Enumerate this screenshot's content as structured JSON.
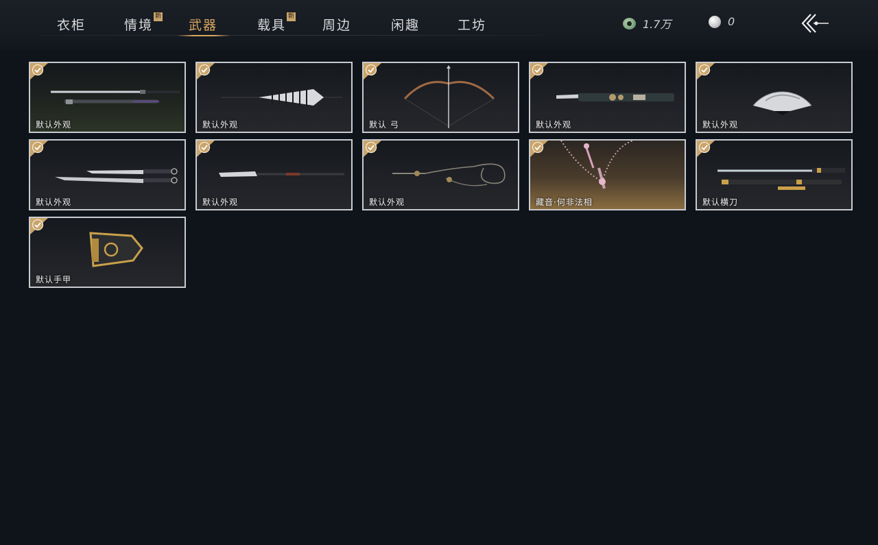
{
  "tabs": [
    {
      "label": "衣柜",
      "new": false,
      "active": false
    },
    {
      "label": "情境",
      "new": true,
      "active": false
    },
    {
      "label": "武器",
      "new": false,
      "active": true
    },
    {
      "label": "载具",
      "new": true,
      "active": false
    },
    {
      "label": "周边",
      "new": false,
      "active": false
    },
    {
      "label": "闲趣",
      "new": false,
      "active": false
    },
    {
      "label": "工坊",
      "new": false,
      "active": false
    }
  ],
  "new_badge": "新",
  "currency": {
    "coins": {
      "icon": "jade-coin-icon",
      "value": "1.7万"
    },
    "pearls": {
      "icon": "pearl-icon",
      "value": "0"
    }
  },
  "items": [
    {
      "label": "默认外观",
      "icon": "sword-pair-icon",
      "selected": true
    },
    {
      "label": "默认外观",
      "icon": "umbrella-icon",
      "selected": true
    },
    {
      "label": "默认 弓",
      "icon": "bow-icon",
      "selected": true
    },
    {
      "label": "默认外观",
      "icon": "blade-icon",
      "selected": true
    },
    {
      "label": "默认外观",
      "icon": "fan-icon",
      "selected": true
    },
    {
      "label": "默认外观",
      "icon": "dual-blades-icon",
      "selected": true
    },
    {
      "label": "默认外观",
      "icon": "spear-icon",
      "selected": true
    },
    {
      "label": "默认外观",
      "icon": "rope-dart-icon",
      "selected": true
    },
    {
      "label": "藏音·何非法相",
      "icon": "prayer-beads-icon",
      "selected": true
    },
    {
      "label": "默认横刀",
      "icon": "hengdao-icon",
      "selected": true
    },
    {
      "label": "默认手甲",
      "icon": "gauntlet-icon",
      "selected": true
    }
  ],
  "colors": {
    "accent": "#d8a760",
    "check": "#c9a46a",
    "card_border": "#c8ccd1",
    "background": "#0f131a"
  }
}
